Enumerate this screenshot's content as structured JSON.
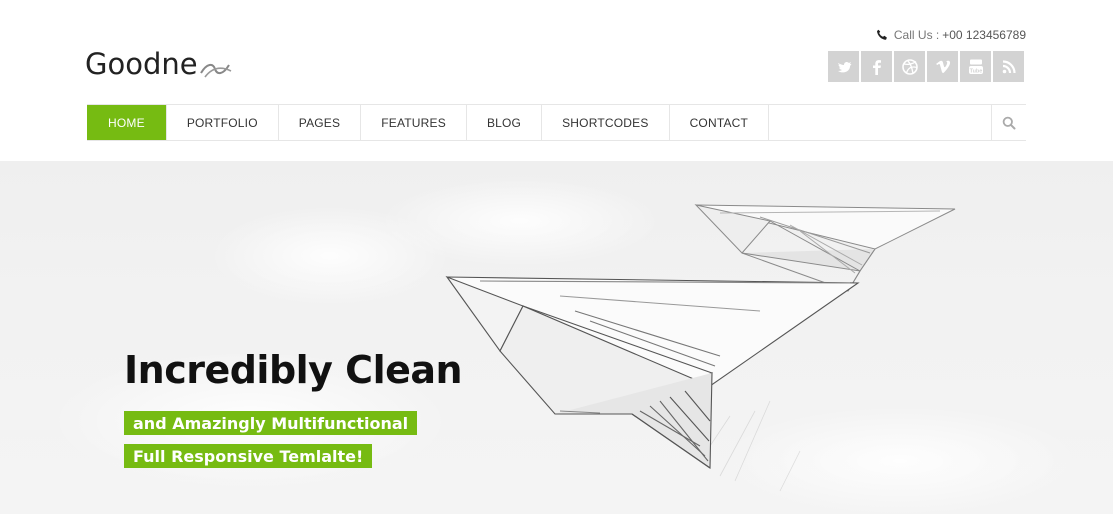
{
  "header": {
    "logo_text": "Goodne",
    "call_label": "Call Us :",
    "call_number": "+00 123456789",
    "social": [
      {
        "icon": "twitter-icon"
      },
      {
        "icon": "facebook-icon"
      },
      {
        "icon": "dribbble-icon"
      },
      {
        "icon": "vimeo-icon"
      },
      {
        "icon": "youtube-icon"
      },
      {
        "icon": "rss-icon"
      }
    ]
  },
  "nav": {
    "items": [
      "HOME",
      "PORTFOLIO",
      "PAGES",
      "FEATURES",
      "BLOG",
      "SHORTCODES",
      "CONTACT"
    ],
    "active": "HOME"
  },
  "hero": {
    "title": "Incredibly Clean",
    "tagline1": "and Amazingly Multifunctional",
    "tagline2": "Full Responsive Temlalte!"
  },
  "colors": {
    "accent": "#76bb12",
    "social_bg": "#d3d3d3",
    "hero_bg": "#f2f2f2"
  }
}
